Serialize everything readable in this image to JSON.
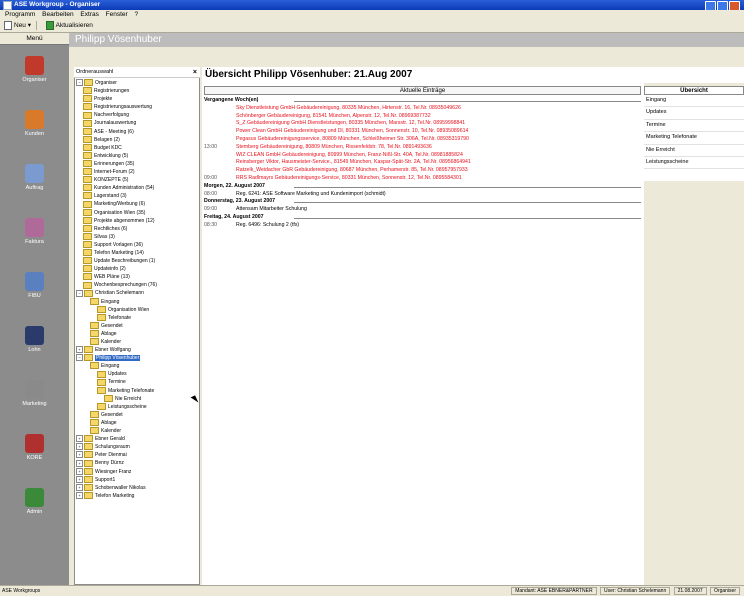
{
  "window": {
    "title": "ASE Workgroup - Organiser"
  },
  "menu": [
    "Programm",
    "Bearbeiten",
    "Extras",
    "Fenster",
    "?"
  ],
  "toolbar": {
    "new_label": "Neu",
    "refresh_label": "Aktualisieren"
  },
  "rail": {
    "header": "Menü",
    "items": [
      {
        "label": "Organiser",
        "color": "#c0392b"
      },
      {
        "label": "Kunden",
        "color": "#d97a2a"
      },
      {
        "label": "Auftrag",
        "color": "#7a9ad0"
      },
      {
        "label": "Faktura",
        "color": "#b06a9a"
      },
      {
        "label": "FIBU",
        "color": "#5a80c0"
      },
      {
        "label": "Lohn",
        "color": "#2a3a6a"
      },
      {
        "label": "Marketing",
        "color": "#8a8a8a"
      },
      {
        "label": "KORE",
        "color": "#b03030"
      },
      {
        "label": "Admin",
        "color": "#3a8a3a"
      }
    ]
  },
  "title_strip": "Philipp Vösenhuber",
  "tree": {
    "header": "Ordnerauswahl",
    "nodes": [
      {
        "label": "Organiser",
        "indent": 0
      },
      {
        "label": "Registrierungen",
        "indent": 1
      },
      {
        "label": "Projekte",
        "indent": 1
      },
      {
        "label": "Registrierungsauswertung",
        "indent": 1
      },
      {
        "label": "Nachverfolgung",
        "indent": 1
      },
      {
        "label": "Journalauswertung",
        "indent": 1
      },
      {
        "label": "ASE - Meeting (6)",
        "indent": 1
      },
      {
        "label": "Belagen (2)",
        "indent": 1
      },
      {
        "label": "Budget KDC",
        "indent": 1
      },
      {
        "label": "Entwicklung (5)",
        "indent": 1
      },
      {
        "label": "Erinnerungen (35)",
        "indent": 1
      },
      {
        "label": "Internet-Forum (2)",
        "indent": 1
      },
      {
        "label": "KONZEPTE (5)",
        "indent": 1
      },
      {
        "label": "Kunden Administration (54)",
        "indent": 1
      },
      {
        "label": "Lagerstand (3)",
        "indent": 1
      },
      {
        "label": "Marketing/Werbung (6)",
        "indent": 1
      },
      {
        "label": "Organisation Wien (35)",
        "indent": 1
      },
      {
        "label": "Projekte abgenommen (12)",
        "indent": 1
      },
      {
        "label": "Rechtliches (6)",
        "indent": 1
      },
      {
        "label": "Silvas (3)",
        "indent": 1
      },
      {
        "label": "Support Vorlagen (36)",
        "indent": 1
      },
      {
        "label": "Telefon Marketing (14)",
        "indent": 1
      },
      {
        "label": "Update Beschreibungen (1)",
        "indent": 1
      },
      {
        "label": "Updateinfo (2)",
        "indent": 1
      },
      {
        "label": "WEB Pläne (13)",
        "indent": 1
      },
      {
        "label": "Wochenbesprechungen (76)",
        "indent": 1
      },
      {
        "label": "Christian Schelemann",
        "indent": 0
      },
      {
        "label": "Eingang",
        "indent": 2
      },
      {
        "label": "Organisation Wien",
        "indent": 3
      },
      {
        "label": "Telefonate",
        "indent": 3
      },
      {
        "label": "Gesendet",
        "indent": 2
      },
      {
        "label": "Ablage",
        "indent": 2
      },
      {
        "label": "Kalender",
        "indent": 2
      },
      {
        "label": "Ebner Wolfgang",
        "indent": 0
      },
      {
        "label": "Philipp Vösenhuber",
        "indent": 0,
        "selected": true
      },
      {
        "label": "Eingang",
        "indent": 2
      },
      {
        "label": "Updates",
        "indent": 3
      },
      {
        "label": "Termine",
        "indent": 3
      },
      {
        "label": "Marketing Telefonate",
        "indent": 3
      },
      {
        "label": "Nie Erreicht",
        "indent": 4
      },
      {
        "label": "Leistungsscheine",
        "indent": 3
      },
      {
        "label": "Gesendet",
        "indent": 2
      },
      {
        "label": "Ablage",
        "indent": 2
      },
      {
        "label": "Kalender",
        "indent": 2
      },
      {
        "label": "Ebner Gerald",
        "indent": 0
      },
      {
        "label": "Schulungsraum",
        "indent": 0
      },
      {
        "label": "Peter Dienmai",
        "indent": 0
      },
      {
        "label": "Benny Dürnz",
        "indent": 0
      },
      {
        "label": "Wiesinger Franz",
        "indent": 0
      },
      {
        "label": "Support1",
        "indent": 0
      },
      {
        "label": "Schobenwaller Nikolas",
        "indent": 0
      },
      {
        "label": "Telefon Marketing",
        "indent": 0
      }
    ]
  },
  "main": {
    "heading": "Übersicht Philipp Vösenhuber: 21.Aug 2007",
    "column_header": "Aktuelle Einträge",
    "rows": [
      {
        "kind": "group",
        "text": "Vergangene Woch(en)"
      },
      {
        "kind": "red",
        "time": "",
        "text": "Sky Dienstleistung GmbH Gebäudereinigung, 80335 München, Hirtenstr. 16, Tel.Nr. 08935049626"
      },
      {
        "kind": "red",
        "time": "",
        "text": "Schönberger Gebäudereinigung, 81541 München, Alpenstr. 12, Tel.Nr. 08969387732"
      },
      {
        "kind": "red",
        "time": "",
        "text": "S_Z Gebäudereinigung GmbH Dienstleistungen, 80335 München, Marsstr. 12, Tel.Nr. 08959998841"
      },
      {
        "kind": "red",
        "time": "",
        "text": "Power Clean GmbH Gebäudereinigung und Dl, 80331 München, Sonnenstr. 10, Tel.Nr. 08935089614"
      },
      {
        "kind": "red",
        "time": "",
        "text": "Pegasus Gebäudereinigungsservice, 80809 München, Schleißheimer Str. 306A, Tel.Nr. 08935319790"
      },
      {
        "kind": "red",
        "time": "13:00",
        "text": "Stemberg Gebäudereinigung, 80809 München, Rissenfeldstr. 78, Tel.Nr. 0891493636"
      },
      {
        "kind": "red",
        "time": "",
        "text": "WIZ CLEAN GmbH Gebäudereinigung, 80999 München, Franz-Nißl-Str. 40A, Tel.Nr. 08981885824"
      },
      {
        "kind": "red",
        "time": "",
        "text": "Reinsberger Viktor, Hausmeister-Service., 81549 München, Kaspar-Spät-Str. 2A, Tel.Nr. 08956864941"
      },
      {
        "kind": "red",
        "time": "",
        "text": "Ratzelk_Weidacher GbR Gebäudereinigung, 80687 München, Perhamerstr. 85, Tel.Nr. 08957957933"
      },
      {
        "kind": "red",
        "time": "09:00",
        "text": "RRS Radlmayrs Gebäudereinigungs-Service, 80331 München, Sonnenstr. 12, Tel.Nr. 0895584301"
      },
      {
        "kind": "group",
        "text": "Morgen, 22. August 2007"
      },
      {
        "kind": "normal",
        "time": "08:00",
        "text": "Reg. 6241: ASE Software Marketing und Kundenimport (schmidt)"
      },
      {
        "kind": "group",
        "text": "Donnerstag, 23. August 2007"
      },
      {
        "kind": "normal",
        "time": "09:00",
        "text": "Attensam Mitarbeiter Schulung"
      },
      {
        "kind": "group",
        "text": "Freitag, 24. August 2007"
      },
      {
        "kind": "normal",
        "time": "08:30",
        "text": "Reg. 6496: Schulung 2 (tfs)"
      }
    ]
  },
  "overview": {
    "header": "Übersicht",
    "items": [
      "Eingang",
      "Updates",
      "Termine",
      "Marketing Telefonate",
      "Nie Erreicht",
      "Leistungsscheine"
    ]
  },
  "status": {
    "left": "ASE Workgroups",
    "mandant": "Mandant: ASE EBNER&PARTNER",
    "user": "User: Christian Schelemann",
    "date": "21.08.2007",
    "module": "Organiser"
  }
}
